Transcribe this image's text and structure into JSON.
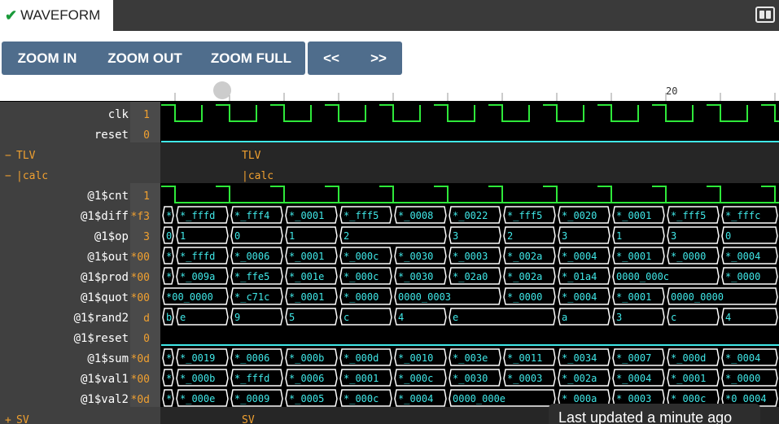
{
  "tab": {
    "label": "WAVEFORM",
    "check_icon": "✔"
  },
  "toolbar": {
    "zoom_in": "ZOOM IN",
    "zoom_out": "ZOOM OUT",
    "zoom_full": "ZOOM FULL",
    "prev": "<<",
    "next": ">>"
  },
  "ruler": {
    "cycle_label": "20"
  },
  "colors": {
    "wave_high": "#2ee83a",
    "wave_low": "#40e8e8",
    "bus_text": "#40e8e8",
    "value_text": "#f0a030",
    "label_bg": "#404040",
    "value_bg": "#4a4a4a"
  },
  "rows": [
    {
      "kind": "signal",
      "name": "clk",
      "value": "1",
      "wave": "clk"
    },
    {
      "kind": "signal",
      "name": "reset",
      "value": "0",
      "wave": "low"
    },
    {
      "kind": "scope",
      "toggle": "−",
      "name": "TLV",
      "label": "TLV"
    },
    {
      "kind": "scope",
      "toggle": "−",
      "name": "  |calc",
      "label": "|calc"
    },
    {
      "kind": "signal",
      "name": "@1$cnt",
      "value": "1",
      "wave": "cnt"
    },
    {
      "kind": "bus",
      "name": "@1$diff",
      "value": "*f3",
      "segments": [
        "*",
        "*_fffd",
        "*_fff4",
        "*_0001",
        "*_fff5",
        "*_0008",
        "*_0022",
        "*_fff5",
        "*_0020",
        "*_0001",
        "*_fff5",
        "*_fffc",
        ""
      ]
    },
    {
      "kind": "bus",
      "name": "@1$op",
      "value": "3",
      "segments": [
        "0",
        "1",
        "0",
        "1",
        "2",
        "",
        "3",
        "2",
        "3",
        "1",
        "3",
        "0",
        ""
      ]
    },
    {
      "kind": "bus",
      "name": "@1$out",
      "value": "*00",
      "segments": [
        "*",
        "*_fffd",
        "*_0006",
        "*_0001",
        "*_000c",
        "*_0030",
        "*_0003",
        "*_002a",
        "*_0004",
        "*_0001",
        "*_0000",
        "*_0004",
        ""
      ]
    },
    {
      "kind": "bus",
      "name": "@1$prod",
      "value": "*00",
      "segments": [
        "*",
        "*_009a",
        "*_ffe5",
        "*_001e",
        "*_000c",
        "*_0030",
        "*_02a0",
        "*_002a",
        "*_01a4",
        "0000_000c",
        "",
        "*_0000",
        ""
      ]
    },
    {
      "kind": "bus",
      "name": "@1$quot",
      "value": "*00",
      "segments": [
        "*00_0000",
        "",
        "*_c71c",
        "*_0001",
        "*_0000",
        "0000_0003",
        "",
        "*_0000",
        "*_0004",
        "*_0001",
        "0000_0000",
        "",
        ""
      ]
    },
    {
      "kind": "bus",
      "name": "@1$rand2",
      "value": "d",
      "segments": [
        "b",
        "e",
        "9",
        "5",
        "c",
        "4",
        "e",
        "",
        "a",
        "3",
        "c",
        "4",
        ""
      ]
    },
    {
      "kind": "signal",
      "name": "@1$reset",
      "value": "0",
      "wave": "low"
    },
    {
      "kind": "bus",
      "name": "@1$sum",
      "value": "*0d",
      "segments": [
        "*",
        "*_0019",
        "*_0006",
        "*_000b",
        "*_000d",
        "*_0010",
        "*_003e",
        "*_0011",
        "*_0034",
        "*_0007",
        "*_000d",
        "*_0004",
        ""
      ]
    },
    {
      "kind": "bus",
      "name": "@1$val1",
      "value": "*00",
      "segments": [
        "*",
        "*_000b",
        "*_fffd",
        "*_0006",
        "*_0001",
        "*_000c",
        "*_0030",
        "*_0003",
        "*_002a",
        "*_0004",
        "*_0001",
        "*_0000",
        ""
      ]
    },
    {
      "kind": "bus",
      "name": "@1$val2",
      "value": "*0d",
      "segments": [
        "*",
        "*_000e",
        "*_0009",
        "*_0005",
        "*_000c",
        "*_0004",
        "0000_000e",
        "",
        "*_000a",
        "*_0003",
        "*_000c",
        "*0_0004",
        ""
      ]
    },
    {
      "kind": "scope",
      "toggle": "+",
      "name": "SV",
      "label": "SV"
    }
  ],
  "toast": "Last updated a minute ago"
}
